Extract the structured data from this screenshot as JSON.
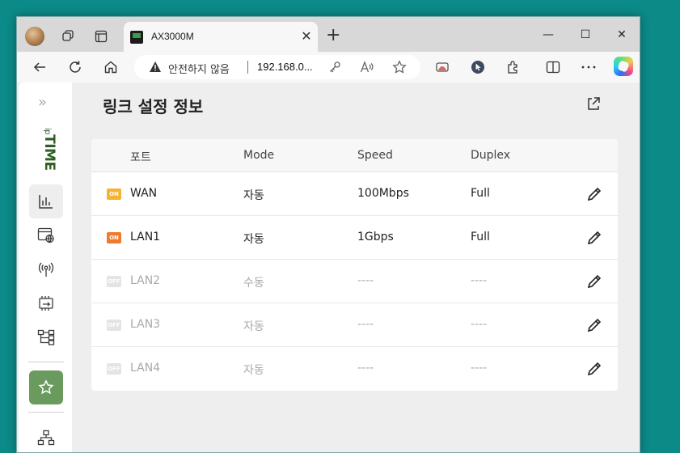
{
  "browser": {
    "tab_title": "AX3000M",
    "security_label": "안전하지 않음",
    "url": "192.168.0...",
    "window_controls": {
      "minimize": "—",
      "maximize": "☐",
      "close": "✕"
    }
  },
  "page": {
    "title": "링크 설정 정보",
    "logo_text": "TIME",
    "logo_prefix": "ip"
  },
  "table": {
    "headers": {
      "port": "포트",
      "mode": "Mode",
      "speed": "Speed",
      "duplex": "Duplex"
    },
    "rows": [
      {
        "status": "ON",
        "port": "WAN",
        "mode": "자동",
        "speed": "100Mbps",
        "duplex": "Full"
      },
      {
        "status": "ON",
        "port": "LAN1",
        "mode": "자동",
        "speed": "1Gbps",
        "duplex": "Full"
      },
      {
        "status": "OFF",
        "port": "LAN2",
        "mode": "수동",
        "speed": "----",
        "duplex": "----"
      },
      {
        "status": "OFF",
        "port": "LAN3",
        "mode": "자동",
        "speed": "----",
        "duplex": "----"
      },
      {
        "status": "OFF",
        "port": "LAN4",
        "mode": "자동",
        "speed": "----",
        "duplex": "----"
      }
    ]
  },
  "colors": {
    "accent_green": "#6b9a5e",
    "on_badge_yellow": "#f2b431",
    "on_badge_orange": "#ee7b2d",
    "off_badge": "#e4e4e4"
  },
  "icons": {
    "sidebar": [
      "expand-icon",
      "chart-icon",
      "web-icon",
      "wireless-icon",
      "hardware-icon",
      "network-tree-icon",
      "star-icon",
      "topology-icon"
    ]
  }
}
